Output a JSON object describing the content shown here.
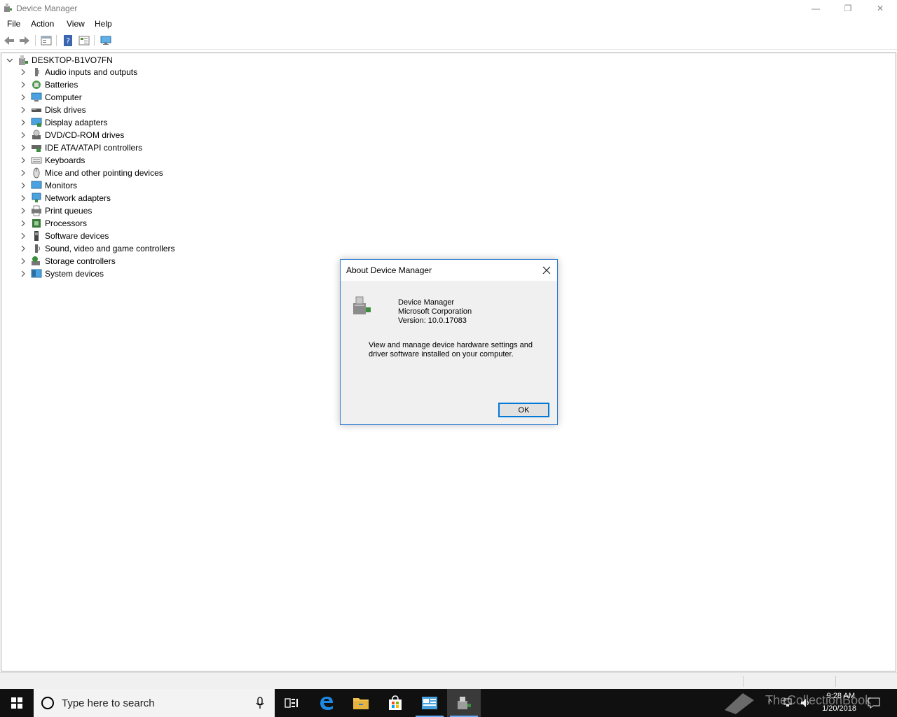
{
  "window": {
    "title": "Device Manager",
    "controls": {
      "minimize": "—",
      "restore": "❐",
      "close": "✕"
    }
  },
  "menu": [
    "File",
    "Action",
    "View",
    "Help"
  ],
  "toolbar": {
    "buttons": [
      "back-icon",
      "forward-icon",
      "properties-icon",
      "help-icon",
      "details-view-icon",
      "monitor-scan-icon"
    ]
  },
  "tree": {
    "root": "DESKTOP-B1VO7FN",
    "items": [
      {
        "label": "Audio inputs and outputs",
        "icon": "speaker-icon"
      },
      {
        "label": "Batteries",
        "icon": "battery-icon"
      },
      {
        "label": "Computer",
        "icon": "computer-icon"
      },
      {
        "label": "Disk drives",
        "icon": "disk-drive-icon"
      },
      {
        "label": "Display adapters",
        "icon": "display-adapter-icon"
      },
      {
        "label": "DVD/CD-ROM drives",
        "icon": "dvd-drive-icon"
      },
      {
        "label": "IDE ATA/ATAPI controllers",
        "icon": "ide-controller-icon"
      },
      {
        "label": "Keyboards",
        "icon": "keyboard-icon"
      },
      {
        "label": "Mice and other pointing devices",
        "icon": "mouse-icon"
      },
      {
        "label": "Monitors",
        "icon": "monitor-icon"
      },
      {
        "label": "Network adapters",
        "icon": "network-adapter-icon"
      },
      {
        "label": "Print queues",
        "icon": "printer-icon"
      },
      {
        "label": "Processors",
        "icon": "processor-icon"
      },
      {
        "label": "Software devices",
        "icon": "software-device-icon"
      },
      {
        "label": "Sound, video and game controllers",
        "icon": "sound-controller-icon"
      },
      {
        "label": "Storage controllers",
        "icon": "storage-controller-icon"
      },
      {
        "label": "System devices",
        "icon": "system-device-icon"
      }
    ]
  },
  "dialog": {
    "title": "About Device Manager",
    "product": "Device Manager",
    "company": "Microsoft Corporation",
    "version": "Version: 10.0.17083",
    "description": "View and manage device hardware settings and driver software installed on your computer.",
    "ok_label": "OK",
    "close": "✕"
  },
  "taskbar": {
    "search_placeholder": "Type here to search",
    "time": "9:28 AM",
    "date": "1/20/2018",
    "watermark": "TheCollectionBook"
  }
}
